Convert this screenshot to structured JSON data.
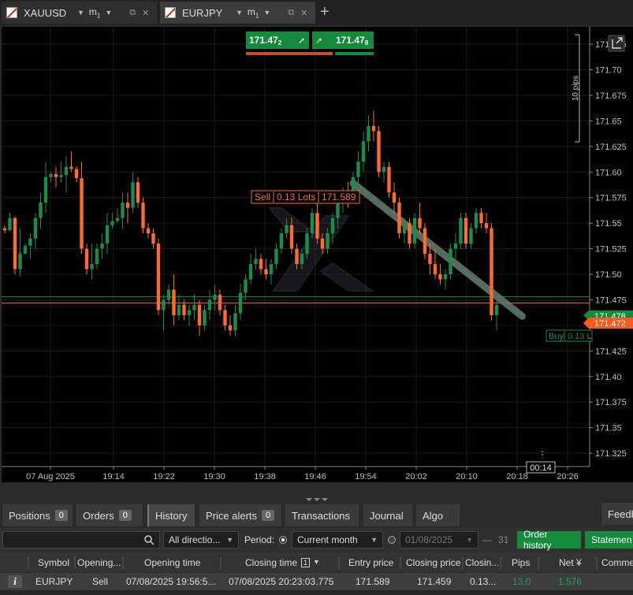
{
  "tabs": [
    {
      "symbol": "XAUUSD",
      "timeframe": "m",
      "timeframe_sub": "1"
    },
    {
      "symbol": "EURJPY",
      "timeframe": "m",
      "timeframe_sub": "1"
    }
  ],
  "chart": {
    "sell_price_main": "171.47",
    "sell_price_sub": "2",
    "buy_price_main": "171.47",
    "buy_price_sub": "8",
    "range_label": "10 pips",
    "position_label": {
      "side": "Sell",
      "lots": "0.13 Lots",
      "price": "171.589"
    },
    "buy_label": {
      "side": "Buy",
      "lots": "0.13 L"
    },
    "ask_tag": "171.478",
    "bid_tag": "171.472",
    "time_marker": "00:14"
  },
  "chart_data": {
    "type": "candlestick",
    "symbol": "EURJPY",
    "timeframe": "m1",
    "x_ticks": [
      "07 Aug 2025",
      "19:14",
      "19:22",
      "19:30",
      "19:38",
      "19:46",
      "19:54",
      "20:02",
      "20:10",
      "20:18",
      "20:26"
    ],
    "y_ticks": [
      "171.725",
      "171.70",
      "171.675",
      "171.65",
      "171.625",
      "171.60",
      "171.575",
      "171.55",
      "171.525",
      "171.50",
      "171.475",
      "171.45",
      "171.425",
      "171.40",
      "171.375",
      "171.35",
      "171.325"
    ],
    "ylim": [
      171.312,
      171.742
    ],
    "ask": 171.478,
    "bid": 171.472,
    "colors": {
      "up": "#1c8c4c",
      "down": "#ff6a2e",
      "grid": "#1b1b1b",
      "axis_text": "#bbbbbb"
    },
    "trade_line": {
      "from_index": 68,
      "from_price": 171.589,
      "to_index": 101,
      "to_price": 171.459
    },
    "candles": [
      [
        171.545,
        171.548,
        171.54,
        171.543
      ],
      [
        171.543,
        171.56,
        171.542,
        171.555
      ],
      [
        171.555,
        171.557,
        171.5,
        171.505
      ],
      [
        171.505,
        171.545,
        171.498,
        171.52
      ],
      [
        171.52,
        171.53,
        171.525,
        171.528
      ],
      [
        171.528,
        171.54,
        171.515,
        171.535
      ],
      [
        171.535,
        171.56,
        171.525,
        171.555
      ],
      [
        171.555,
        171.58,
        171.545,
        171.57
      ],
      [
        171.57,
        171.61,
        171.56,
        171.595
      ],
      [
        171.595,
        171.6,
        171.59,
        171.598
      ],
      [
        171.598,
        171.605,
        171.585,
        171.595
      ],
      [
        171.595,
        171.61,
        171.59,
        171.597
      ],
      [
        171.597,
        171.615,
        171.58,
        171.605
      ],
      [
        171.605,
        171.62,
        171.6,
        171.603
      ],
      [
        171.603,
        171.606,
        171.59,
        171.594
      ],
      [
        171.594,
        171.61,
        171.52,
        171.525
      ],
      [
        171.525,
        171.53,
        171.5,
        171.505
      ],
      [
        171.505,
        171.53,
        171.495,
        171.51
      ],
      [
        171.51,
        171.53,
        171.505,
        171.525
      ],
      [
        171.525,
        171.54,
        171.515,
        171.53
      ],
      [
        171.53,
        171.56,
        171.52,
        171.548
      ],
      [
        171.548,
        171.56,
        171.545,
        171.552
      ],
      [
        171.552,
        171.565,
        171.55,
        171.555
      ],
      [
        171.555,
        171.58,
        171.545,
        171.57
      ],
      [
        171.57,
        171.58,
        171.55,
        171.565
      ],
      [
        171.565,
        171.6,
        171.56,
        171.59
      ],
      [
        171.59,
        171.595,
        171.565,
        171.57
      ],
      [
        171.57,
        171.575,
        171.54,
        171.545
      ],
      [
        171.545,
        171.55,
        171.535,
        171.54
      ],
      [
        171.54,
        171.545,
        171.525,
        171.53
      ],
      [
        171.53,
        171.535,
        171.46,
        171.465
      ],
      [
        171.465,
        171.48,
        171.445,
        171.475
      ],
      [
        171.475,
        171.49,
        171.47,
        171.485
      ],
      [
        171.485,
        171.5,
        171.45,
        171.46
      ],
      [
        171.46,
        171.48,
        171.455,
        171.47
      ],
      [
        171.47,
        171.475,
        171.455,
        171.46
      ],
      [
        171.46,
        171.47,
        171.45,
        171.465
      ],
      [
        171.465,
        171.48,
        171.455,
        171.47
      ],
      [
        171.47,
        171.475,
        171.44,
        171.45
      ],
      [
        171.45,
        171.47,
        171.445,
        171.465
      ],
      [
        171.465,
        171.485,
        171.455,
        171.475
      ],
      [
        171.475,
        171.49,
        171.465,
        171.48
      ],
      [
        171.48,
        171.485,
        171.46,
        171.465
      ],
      [
        171.465,
        171.47,
        171.445,
        171.45
      ],
      [
        171.45,
        171.46,
        171.44,
        171.445
      ],
      [
        171.445,
        171.47,
        171.44,
        171.462
      ],
      [
        171.462,
        171.49,
        171.455,
        171.482
      ],
      [
        171.482,
        171.5,
        171.475,
        171.495
      ],
      [
        171.495,
        171.52,
        171.49,
        171.51
      ],
      [
        171.51,
        171.525,
        171.505,
        171.515
      ],
      [
        171.515,
        171.52,
        171.5,
        171.505
      ],
      [
        171.505,
        171.515,
        171.495,
        171.5
      ],
      [
        171.5,
        171.515,
        171.49,
        171.51
      ],
      [
        171.51,
        171.53,
        171.505,
        171.525
      ],
      [
        171.525,
        171.545,
        171.52,
        171.54
      ],
      [
        171.54,
        171.555,
        171.535,
        171.548
      ],
      [
        171.548,
        171.555,
        171.52,
        171.525
      ],
      [
        171.525,
        171.53,
        171.505,
        171.51
      ],
      [
        171.51,
        171.525,
        171.505,
        171.52
      ],
      [
        171.52,
        171.545,
        171.515,
        171.54
      ],
      [
        171.54,
        171.565,
        171.535,
        171.56
      ],
      [
        171.56,
        171.57,
        171.53,
        171.535
      ],
      [
        171.535,
        171.54,
        171.52,
        171.525
      ],
      [
        171.525,
        171.545,
        171.52,
        171.54
      ],
      [
        171.54,
        171.56,
        171.53,
        171.555
      ],
      [
        171.555,
        171.575,
        171.545,
        171.57
      ],
      [
        171.57,
        171.585,
        171.56,
        171.58
      ],
      [
        171.58,
        171.59,
        171.565,
        171.575
      ],
      [
        171.575,
        171.6,
        171.57,
        171.595
      ],
      [
        171.595,
        171.62,
        171.585,
        171.61
      ],
      [
        171.61,
        171.64,
        171.6,
        171.63
      ],
      [
        171.63,
        171.655,
        171.62,
        171.645
      ],
      [
        171.645,
        171.66,
        171.63,
        171.64
      ],
      [
        171.64,
        171.645,
        171.595,
        171.6
      ],
      [
        171.6,
        171.61,
        171.59,
        171.605
      ],
      [
        171.605,
        171.61,
        171.575,
        171.58
      ],
      [
        171.58,
        171.59,
        171.56,
        171.57
      ],
      [
        171.57,
        171.575,
        171.535,
        171.54
      ],
      [
        171.54,
        171.555,
        171.53,
        171.55
      ],
      [
        171.55,
        171.555,
        171.525,
        171.53
      ],
      [
        171.53,
        171.56,
        171.525,
        171.555
      ],
      [
        171.555,
        171.57,
        171.54,
        171.545
      ],
      [
        171.545,
        171.55,
        171.515,
        171.52
      ],
      [
        171.52,
        171.53,
        171.5,
        171.51
      ],
      [
        171.51,
        171.525,
        171.495,
        171.5
      ],
      [
        171.5,
        171.51,
        171.49,
        171.495
      ],
      [
        171.495,
        171.505,
        171.485,
        171.5
      ],
      [
        171.5,
        171.53,
        171.495,
        171.525
      ],
      [
        171.525,
        171.54,
        171.515,
        171.53
      ],
      [
        171.53,
        171.56,
        171.525,
        171.555
      ],
      [
        171.555,
        171.56,
        171.525,
        171.53
      ],
      [
        171.53,
        171.55,
        171.525,
        171.545
      ],
      [
        171.545,
        171.565,
        171.54,
        171.56
      ],
      [
        171.56,
        171.565,
        171.545,
        171.55
      ],
      [
        171.55,
        171.56,
        171.54,
        171.545
      ],
      [
        171.545,
        171.55,
        171.455,
        171.46
      ],
      [
        171.46,
        171.475,
        171.445,
        171.47
      ]
    ]
  },
  "panel": {
    "tabs": [
      {
        "label": "Positions",
        "count": "0"
      },
      {
        "label": "Orders",
        "count": "0"
      },
      {
        "label": "History"
      },
      {
        "label": "Price alerts",
        "count": "0"
      },
      {
        "label": "Transactions"
      },
      {
        "label": "Journal"
      },
      {
        "label": "Algo"
      },
      {
        "label": "Feedb"
      }
    ],
    "direction_select": "All directio...",
    "period_label": "Period:",
    "period_select": "Current month",
    "date_input": "01/08/2025",
    "date_separator": "—",
    "calendar_icon_text": "31",
    "order_history_button": "Order history",
    "statement_button": "Statemen",
    "columns": [
      "Symbol",
      "Opening...",
      "Opening time",
      "Closing time",
      "Entry price",
      "Closing price",
      "Closin...",
      "Pips",
      "Net ¥",
      "Comme"
    ],
    "sort_rank": "1",
    "row": {
      "info": "i",
      "symbol": "EURJPY",
      "opening": "Sell",
      "opening_time": "07/08/2025 19:56:5...",
      "closing_time": "07/08/2025 20:23:03.775",
      "entry_price": "171.589",
      "closing_price": "171.459",
      "closing": "0.13...",
      "pips": "13.0",
      "net": "1.576"
    }
  }
}
